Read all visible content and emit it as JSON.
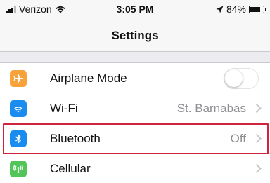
{
  "status_bar": {
    "carrier": "Verizon",
    "time": "3:05 PM",
    "battery_percent": "84%",
    "battery_level": 0.84
  },
  "nav": {
    "title": "Settings"
  },
  "settings": {
    "rows": [
      {
        "label": "Airplane Mode",
        "value": "",
        "control": "toggle",
        "toggle_on": false,
        "icon": "airplane-icon",
        "icon_color": "#f7a23b"
      },
      {
        "label": "Wi-Fi",
        "value": "St. Barnabas",
        "control": "chevron",
        "icon": "wifi-icon",
        "icon_color": "#1a8cf0"
      },
      {
        "label": "Bluetooth",
        "value": "Off",
        "control": "chevron",
        "icon": "bluetooth-icon",
        "icon_color": "#1a8cf0",
        "highlighted": true
      },
      {
        "label": "Cellular",
        "value": "",
        "control": "chevron",
        "icon": "cellular-icon",
        "icon_color": "#52c45a"
      }
    ]
  },
  "colors": {
    "highlight_border": "#d0243c",
    "secondary_text": "#8e8e93"
  }
}
